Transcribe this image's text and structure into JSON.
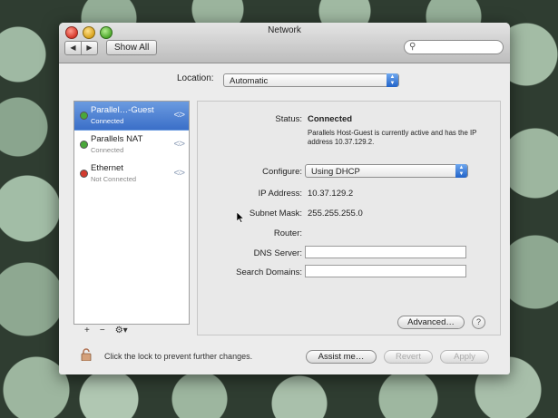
{
  "window": {
    "title": "Network"
  },
  "toolbar": {
    "back_label": "◀",
    "forward_label": "▶",
    "show_all_label": "Show All",
    "search_placeholder": ""
  },
  "location": {
    "label": "Location:",
    "value": "Automatic"
  },
  "services": [
    {
      "name": "Parallel…-Guest",
      "status": "Connected",
      "color": "#4aa83a",
      "selected": true
    },
    {
      "name": "Parallels NAT",
      "status": "Connected",
      "color": "#4aa83a",
      "selected": false
    },
    {
      "name": "Ethernet",
      "status": "Not Connected",
      "color": "#d33b2f",
      "selected": false
    }
  ],
  "service_controls": {
    "add": "+",
    "remove": "−",
    "action": "⚙▾"
  },
  "detail": {
    "status_label": "Status:",
    "status_value": "Connected",
    "status_desc": "Parallels Host-Guest is currently active and has the IP address 10.37.129.2.",
    "configure_label": "Configure:",
    "configure_value": "Using DHCP",
    "ip_label": "IP Address:",
    "ip_value": "10.37.129.2",
    "subnet_label": "Subnet Mask:",
    "subnet_value": "255.255.255.0",
    "router_label": "Router:",
    "router_value": "",
    "dns_label": "DNS Server:",
    "dns_value": "",
    "search_domains_label": "Search Domains:",
    "search_domains_value": "",
    "advanced_label": "Advanced…",
    "help_label": "?"
  },
  "footer": {
    "lock_text": "Click the lock to prevent further changes.",
    "assist_label": "Assist me…",
    "revert_label": "Revert",
    "apply_label": "Apply"
  }
}
